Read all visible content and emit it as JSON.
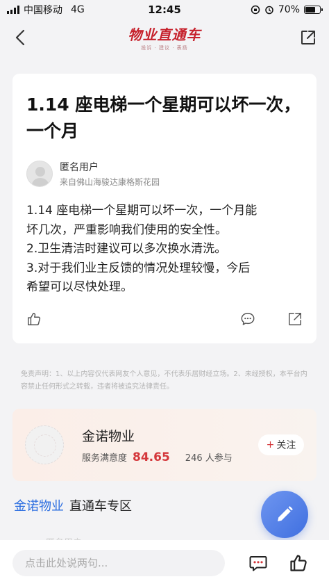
{
  "status_bar": {
    "carrier": "中国移动",
    "network": "4G",
    "time": "12:45",
    "battery_percent_label": "70%",
    "battery_level": 0.7
  },
  "header": {
    "logo_text": "物业直通车",
    "logo_subtitle": "投诉 · 建议 · 表扬"
  },
  "post": {
    "title": "1.14 座电梯一个星期可以坏一次，一个月",
    "author_name": "匿名用户",
    "author_from": "来自佛山海骏达康格斯花园",
    "body_lines": [
      "1.14 座电梯一个星期可以坏一次，一个月能",
      "坏几次，严重影响我们使用的安全性。",
      "2.卫生清洁时建议可以多次换水清洗。",
      "3.对于我们业主反馈的情况处理较慢，今后",
      "希望可以尽快处理。"
    ]
  },
  "disclaimer": "免责声明：1、以上内容仅代表网友个人意见，不代表乐居财经立场。2、未经授权，本平台内容禁止任何形式之转载，违者将被追究法律责任。",
  "company": {
    "name": "金诺物业",
    "satisfaction_label": "服务满意度",
    "satisfaction_score": "84.65",
    "participants": "246 人参与",
    "follow_label": "关注"
  },
  "zone": {
    "company": "金诺物业",
    "label": "直通车专区"
  },
  "peek_text": "匿名用户",
  "bottom_bar": {
    "comment_placeholder": "点击此处说两句..."
  },
  "colors": {
    "brand_red": "#c6202b",
    "score_red": "#d4373b",
    "link_blue": "#2a6de0",
    "fab_blue": "#4a7be6"
  },
  "icons": [
    "back-icon",
    "share-icon",
    "like-icon",
    "comment-icon",
    "share-post-icon",
    "edit-pen-icon",
    "message-icon",
    "thumbs-up-icon"
  ]
}
